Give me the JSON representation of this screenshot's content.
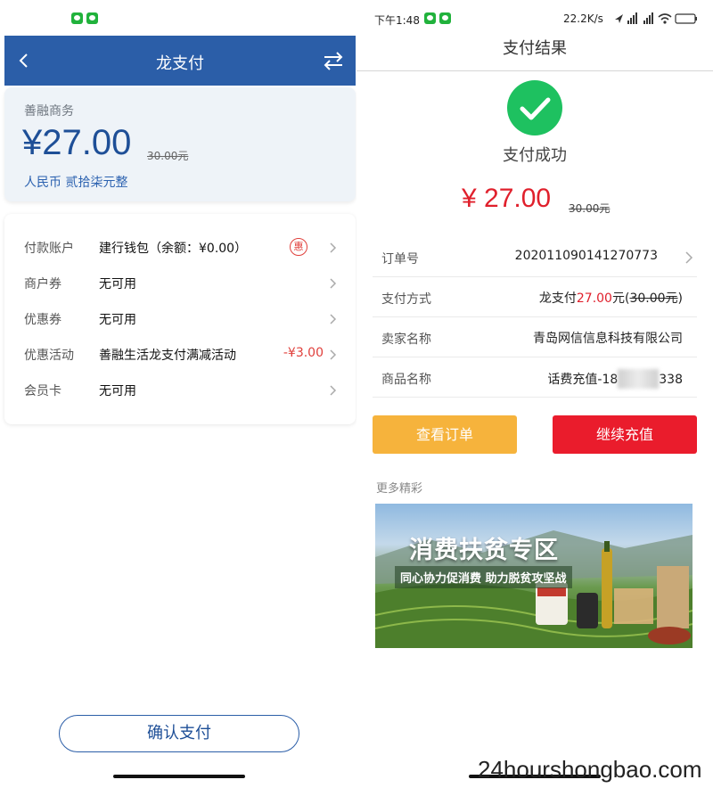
{
  "left": {
    "header": {
      "title": "龙支付",
      "back_icon": "chevron-left-icon",
      "switch_icon": "swap-arrows-icon"
    },
    "amount_card": {
      "merchant": "善融商务",
      "amount": "¥27.00",
      "original": "30.00元",
      "amount_words": "人民币 贰拾柒元整"
    },
    "rows": [
      {
        "label": "付款账户",
        "value": "建行钱包（余额：¥0.00）",
        "badge": "惠"
      },
      {
        "label": "商户券",
        "value": "无可用"
      },
      {
        "label": "优惠券",
        "value": "无可用"
      },
      {
        "label": "优惠活动",
        "value": "善融生活龙支付满减活动",
        "discount": "-¥3.00"
      },
      {
        "label": "会员卡",
        "value": "无可用"
      }
    ],
    "confirm_label": "确认支付"
  },
  "right": {
    "status_bar": {
      "time": "下午1:48",
      "network_speed": "22.2K/s",
      "battery": "20"
    },
    "header": {
      "title": "支付结果"
    },
    "success_text": "支付成功",
    "amount": "¥ 27.00",
    "original": "30.00元",
    "rows": [
      {
        "label": "订单号",
        "value": "202011090141270773"
      },
      {
        "label": "支付方式",
        "value_prefix": "龙支付",
        "value_amount": "27.00",
        "value_unit": "元(",
        "value_orig": "30.00元",
        "value_close": ")"
      },
      {
        "label": "卖家名称",
        "value": "青岛网信信息科技有限公司"
      },
      {
        "label": "商品名称",
        "value_prefix": "话费充值-18",
        "value_suffix": "338"
      }
    ],
    "view_order_label": "查看订单",
    "continue_label": "继续充值",
    "more_label": "更多精彩",
    "banner": {
      "title": "消费扶贫专区",
      "subtitle": "同心协力促消费 助力脱贫攻坚战"
    },
    "watermark": "24hourshongbao.com"
  },
  "colors": {
    "header_blue": "#2b5ea8",
    "success_green": "#1ec160",
    "price_red": "#e0202c",
    "orange_button": "#f6b33c",
    "red_button": "#ea1c2c"
  }
}
